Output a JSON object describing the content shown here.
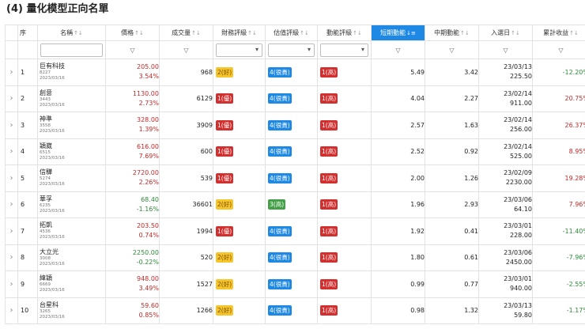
{
  "heading": "(4) 量化模型正向名單",
  "columns": {
    "seq": "序",
    "name": "名稱",
    "price": "價格",
    "volume": "成交量",
    "fin": "財務評級",
    "val": "估值評級",
    "mom": "動能評級",
    "short": "短期動能",
    "mid": "中期動能",
    "entry": "入選日",
    "cum": "累計收益"
  },
  "sort_icon": "↑↓",
  "sort_icon_active": "↓≡",
  "rows": [
    {
      "seq": "1",
      "name": "巨有科技",
      "code": "8227",
      "date": "2023/03/16",
      "price": "205.00",
      "chg": "3.54%",
      "dir": "up",
      "volume": "968",
      "fin": "2(好)",
      "fin_c": "yellow",
      "val": "4(很貴)",
      "val_c": "blue",
      "mom": "1(高)",
      "mom_c": "red",
      "short": "5.49",
      "mid": "3.42",
      "entry_date": "23/03/13",
      "entry_price": "225.50",
      "cum": "-12.20%",
      "cum_dir": "down"
    },
    {
      "seq": "2",
      "name": "創意",
      "code": "3443",
      "date": "2023/03/16",
      "price": "1130.00",
      "chg": "2.73%",
      "dir": "up",
      "volume": "6129",
      "fin": "1(優)",
      "fin_c": "red",
      "val": "4(很貴)",
      "val_c": "blue",
      "mom": "1(高)",
      "mom_c": "red",
      "short": "4.04",
      "mid": "2.27",
      "entry_date": "23/02/14",
      "entry_price": "911.00",
      "cum": "20.75%",
      "cum_dir": "up"
    },
    {
      "seq": "3",
      "name": "神準",
      "code": "3558",
      "date": "2023/03/16",
      "price": "328.00",
      "chg": "1.39%",
      "dir": "up",
      "volume": "3909",
      "fin": "1(優)",
      "fin_c": "red",
      "val": "4(很貴)",
      "val_c": "blue",
      "mom": "1(高)",
      "mom_c": "red",
      "short": "2.57",
      "mid": "1.63",
      "entry_date": "23/02/14",
      "entry_price": "256.00",
      "cum": "26.37%",
      "cum_dir": "up"
    },
    {
      "seq": "4",
      "name": "穎崴",
      "code": "6515",
      "date": "2023/03/16",
      "price": "616.00",
      "chg": "7.69%",
      "dir": "up",
      "volume": "600",
      "fin": "1(優)",
      "fin_c": "red",
      "val": "4(很貴)",
      "val_c": "blue",
      "mom": "1(高)",
      "mom_c": "red",
      "short": "2.52",
      "mid": "0.92",
      "entry_date": "23/02/14",
      "entry_price": "525.00",
      "cum": "8.95%",
      "cum_dir": "up"
    },
    {
      "seq": "5",
      "name": "信驊",
      "code": "5274",
      "date": "2023/03/16",
      "price": "2720.00",
      "chg": "2.26%",
      "dir": "up",
      "volume": "539",
      "fin": "1(優)",
      "fin_c": "red",
      "val": "4(很貴)",
      "val_c": "blue",
      "mom": "1(高)",
      "mom_c": "red",
      "short": "2.00",
      "mid": "1.26",
      "entry_date": "23/02/09",
      "entry_price": "2230.00",
      "cum": "19.28%",
      "cum_dir": "up"
    },
    {
      "seq": "6",
      "name": "華孚",
      "code": "6235",
      "date": "2023/03/16",
      "price": "68.40",
      "chg": "-1.16%",
      "dir": "down",
      "volume": "36601",
      "fin": "2(好)",
      "fin_c": "yellow",
      "val": "3(高)",
      "val_c": "green",
      "mom": "1(高)",
      "mom_c": "red",
      "short": "1.96",
      "mid": "2.93",
      "entry_date": "23/03/06",
      "entry_price": "64.10",
      "cum": "7.96%",
      "cum_dir": "up"
    },
    {
      "seq": "7",
      "name": "拓凱",
      "code": "4536",
      "date": "2023/03/16",
      "price": "203.50",
      "chg": "0.74%",
      "dir": "up",
      "volume": "1994",
      "fin": "1(優)",
      "fin_c": "red",
      "val": "4(很貴)",
      "val_c": "blue",
      "mom": "1(高)",
      "mom_c": "red",
      "short": "1.92",
      "mid": "0.41",
      "entry_date": "23/03/01",
      "entry_price": "228.00",
      "cum": "-11.40%",
      "cum_dir": "down"
    },
    {
      "seq": "8",
      "name": "大立光",
      "code": "3008",
      "date": "2023/03/16",
      "price": "2250.00",
      "chg": "-0.22%",
      "dir": "down",
      "volume": "520",
      "fin": "2(好)",
      "fin_c": "yellow",
      "val": "4(很貴)",
      "val_c": "blue",
      "mom": "1(高)",
      "mom_c": "red",
      "short": "1.80",
      "mid": "0.61",
      "entry_date": "23/03/06",
      "entry_price": "2450.00",
      "cum": "-7.96%",
      "cum_dir": "down"
    },
    {
      "seq": "9",
      "name": "緯穎",
      "code": "6669",
      "date": "2023/03/16",
      "price": "948.00",
      "chg": "3.49%",
      "dir": "up",
      "volume": "1527",
      "fin": "2(好)",
      "fin_c": "yellow",
      "val": "4(很貴)",
      "val_c": "blue",
      "mom": "1(高)",
      "mom_c": "red",
      "short": "0.99",
      "mid": "0.77",
      "entry_date": "23/03/01",
      "entry_price": "940.00",
      "cum": "-2.55%",
      "cum_dir": "down"
    },
    {
      "seq": "10",
      "name": "台星科",
      "code": "3265",
      "date": "2023/03/16",
      "price": "59.60",
      "chg": "0.85%",
      "dir": "up",
      "volume": "1266",
      "fin": "2(好)",
      "fin_c": "yellow",
      "val": "4(很貴)",
      "val_c": "blue",
      "mom": "1(高)",
      "mom_c": "red",
      "short": "0.98",
      "mid": "1.32",
      "entry_date": "23/03/13",
      "entry_price": "59.80",
      "cum": "-1.17%",
      "cum_dir": "down"
    }
  ]
}
